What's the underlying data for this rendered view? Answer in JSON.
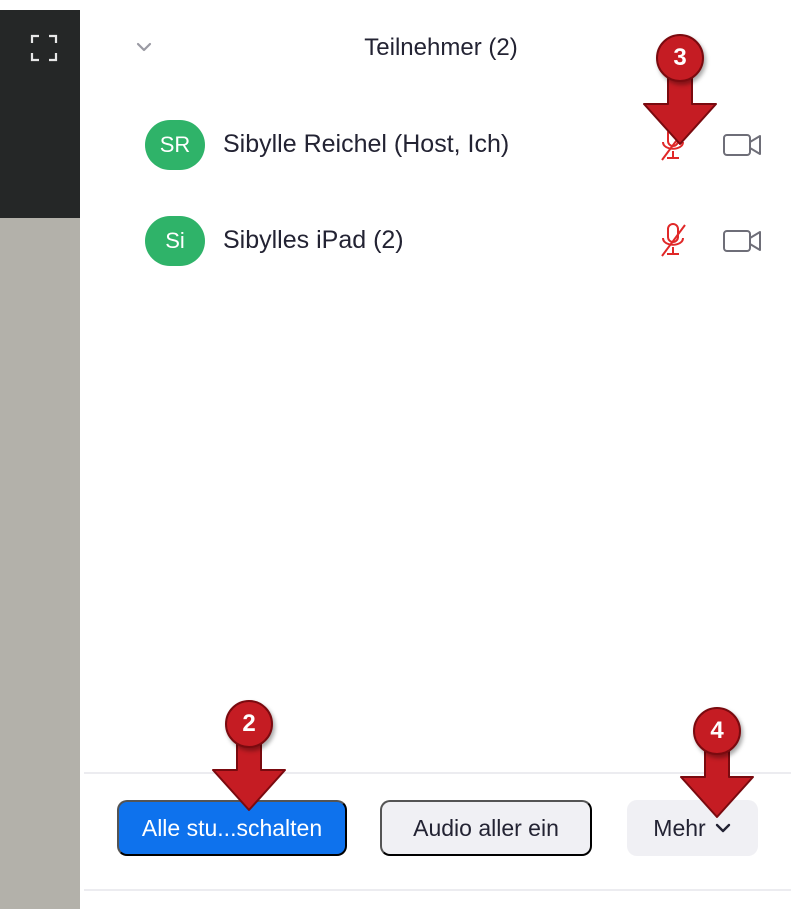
{
  "panel": {
    "title": "Teilnehmer (2)"
  },
  "participants": [
    {
      "initials": "SR",
      "name": "Sibylle Reichel (Host, Ich)",
      "mic": "muted",
      "video": "off"
    },
    {
      "initials": "Si",
      "name": "Sibylles iPad (2)",
      "mic": "muted",
      "video": "off"
    }
  ],
  "footer": {
    "mute_all_label": "Alle stu...schalten",
    "audio_all_label": "Audio aller ein",
    "more_label": "Mehr"
  },
  "annotations": [
    {
      "number": "2"
    },
    {
      "number": "3"
    },
    {
      "number": "4"
    }
  ],
  "colors": {
    "avatar": "#2fb369",
    "primary_button": "#0e72ed",
    "muted_mic": "#e02828",
    "annotation": "#c51c23"
  }
}
